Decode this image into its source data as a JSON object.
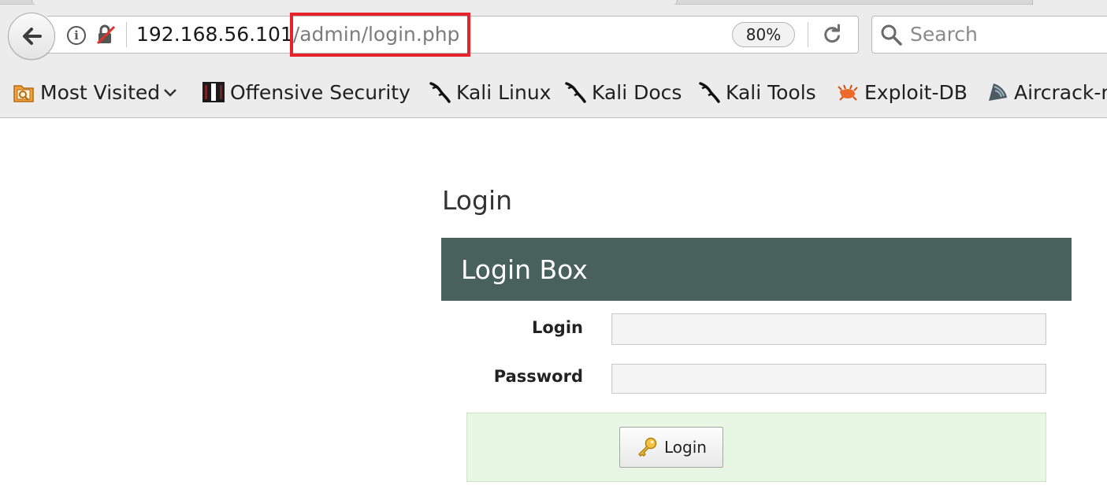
{
  "browser": {
    "url": {
      "host": "192.168.56.101",
      "path": "/admin/login.php"
    },
    "zoom_level": "80%",
    "search_placeholder": "Search",
    "bookmarks": [
      {
        "label": "Most Visited",
        "icon": "most-visited-icon",
        "has_dropdown": true
      },
      {
        "label": "Offensive Security",
        "icon": "offensive-security-icon"
      },
      {
        "label": "Kali Linux",
        "icon": "kali-dragon-icon"
      },
      {
        "label": "Kali Docs",
        "icon": "kali-dragon-icon"
      },
      {
        "label": "Kali Tools",
        "icon": "kali-dragon-icon"
      },
      {
        "label": "Exploit-DB",
        "icon": "exploit-db-icon"
      },
      {
        "label": "Aircrack-n",
        "icon": "aircrack-icon"
      }
    ],
    "highlight_color": "#e8222a"
  },
  "page": {
    "heading": "Login",
    "login_box": {
      "title": "Login Box",
      "header_color": "#48615a",
      "fields": {
        "login_label": "Login",
        "login_value": "",
        "password_label": "Password",
        "password_value": ""
      },
      "submit_label": "Login",
      "actions_bg": "#e7f7e4"
    }
  }
}
